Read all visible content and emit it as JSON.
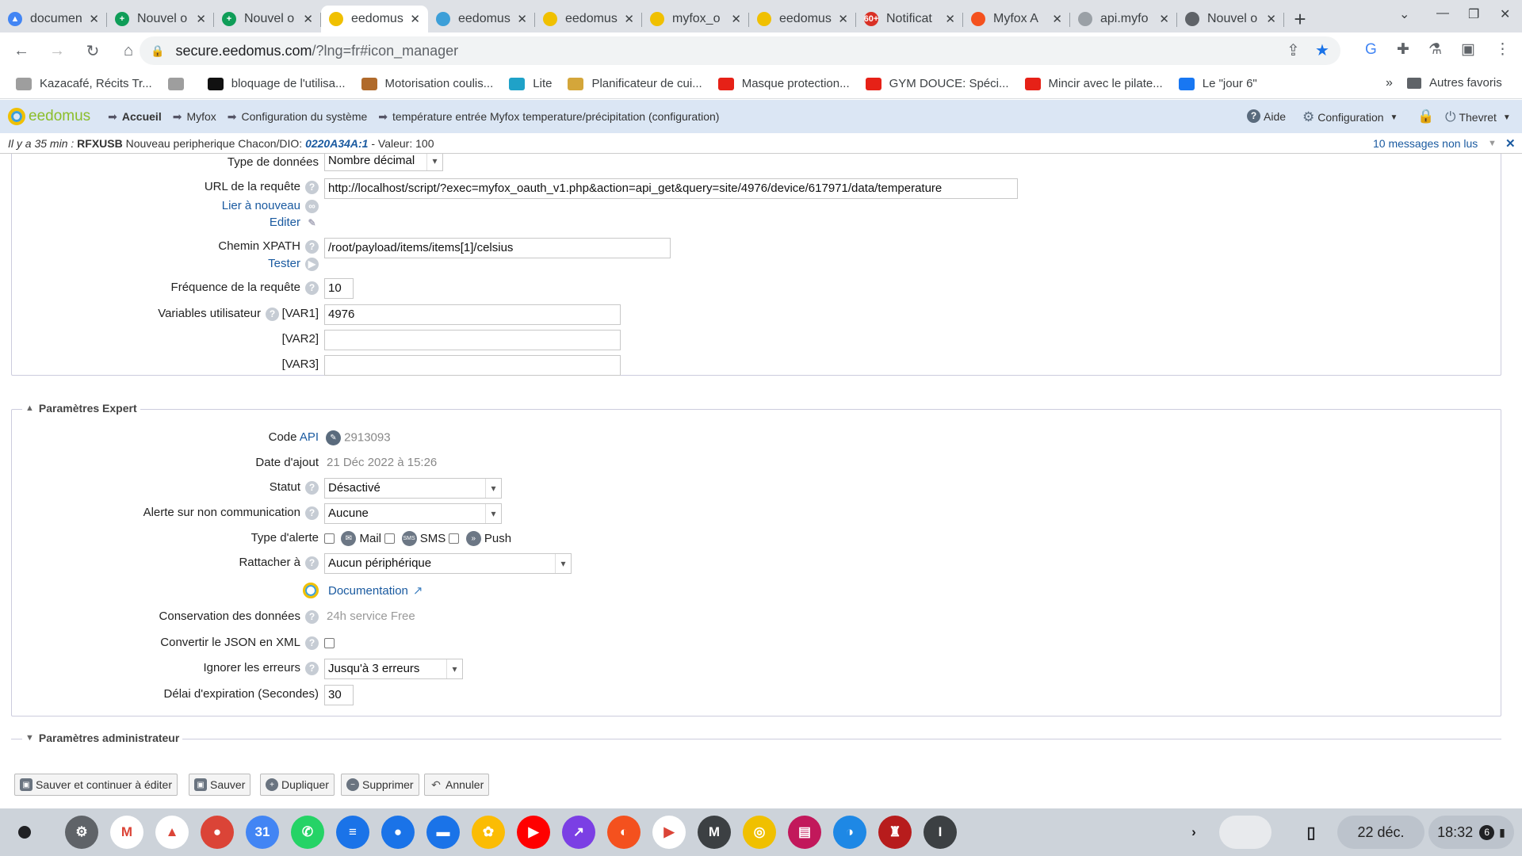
{
  "browser": {
    "tabs": [
      {
        "title": "documen",
        "color": "#4285f4",
        "glyph": "▲",
        "active": false
      },
      {
        "title": "Nouvel o",
        "color": "#0f9d58",
        "glyph": "+",
        "active": false
      },
      {
        "title": "Nouvel o",
        "color": "#0f9d58",
        "glyph": "+",
        "active": false
      },
      {
        "title": "eedomus",
        "color": "#f0c000",
        "glyph": "",
        "active": true
      },
      {
        "title": "eedomus",
        "color": "#3d9fd8",
        "glyph": "",
        "active": false
      },
      {
        "title": "eedomus",
        "color": "#f0c000",
        "glyph": "",
        "active": false
      },
      {
        "title": "myfox_o",
        "color": "#f0c000",
        "glyph": "",
        "active": false
      },
      {
        "title": "eedomus",
        "color": "#f0c000",
        "glyph": "",
        "active": false
      },
      {
        "title": "Notificat",
        "color": "#d93025",
        "glyph": "60+",
        "active": false
      },
      {
        "title": "Myfox A",
        "color": "#f4511e",
        "glyph": "",
        "active": false
      },
      {
        "title": "api.myfo",
        "color": "#9aa0a6",
        "glyph": "",
        "active": false
      },
      {
        "title": "Nouvel o",
        "color": "#5f6368",
        "glyph": "",
        "active": false
      }
    ],
    "url_host": "secure.eedomus.com",
    "url_path": "/?lng=fr#icon_manager",
    "bookmarks": [
      {
        "label": "Kazacafé, Récits Tr...",
        "color": "#9e9e9e"
      },
      {
        "label": "",
        "color": "#9e9e9e"
      },
      {
        "label": "bloquage de l'utilisa...",
        "color": "#111111"
      },
      {
        "label": "Motorisation coulis...",
        "color": "#b06a2b"
      },
      {
        "label": "Lite",
        "color": "#1fa2c8"
      },
      {
        "label": "Planificateur de cui...",
        "color": "#d4a63a"
      },
      {
        "label": "Masque protection...",
        "color": "#e62117"
      },
      {
        "label": "GYM DOUCE: Spéci...",
        "color": "#e62117"
      },
      {
        "label": "Mincir avec le pilate...",
        "color": "#e62117"
      },
      {
        "label": "Le \"jour 6\"",
        "color": "#1877f2"
      }
    ],
    "bookmarks_overflow": "»",
    "other_bookmarks": "Autres favoris"
  },
  "app": {
    "logo": "eedomus",
    "breadcrumb": [
      "Accueil",
      "Myfox",
      "Configuration du système",
      "température entrée Myfox temperature/précipitation (configuration)"
    ],
    "help": "Aide",
    "config": "Configuration",
    "user": "Thevret",
    "notification": {
      "prefix": "Il y a 35 min :",
      "device": "RFXUSB",
      "text": "Nouveau peripherique Chacon/DIO:",
      "code": "0220A34A:1",
      "value": "- Valeur: 100",
      "unread": "10 messages non lus"
    }
  },
  "form": {
    "data_type_label": "Type de données",
    "data_type_value": "Nombre décimal",
    "url_label": "URL de la requête",
    "url_value": "http://localhost/script/?exec=myfox_oauth_v1.php&action=api_get&query=site/4976/device/617971/data/temperature",
    "link_again": "Lier à nouveau",
    "edit": "Editer",
    "xpath_label": "Chemin XPATH",
    "xpath_value": "/root/payload/items/items[1]/celsius",
    "test": "Tester",
    "freq_label": "Fréquence de la requête",
    "freq_value": "10",
    "vars_label": "Variables utilisateur",
    "var1_label": "[VAR1]",
    "var1_value": "4976",
    "var2_label": "[VAR2]",
    "var2_value": "",
    "var3_label": "[VAR3]",
    "var3_value": ""
  },
  "expert": {
    "legend": "Paramètres Expert",
    "api_label": "Code",
    "api_link": "API",
    "api_value": "2913093",
    "date_label": "Date d'ajout",
    "date_value": "21 Déc 2022 à 15:26",
    "status_label": "Statut",
    "status_value": "Désactivé",
    "alert_label": "Alerte sur non communication",
    "alert_value": "Aucune",
    "alert_type_label": "Type d'alerte",
    "alert_mail": "Mail",
    "alert_sms": "SMS",
    "alert_push": "Push",
    "attach_label": "Rattacher à",
    "attach_value": "Aucun périphérique",
    "documentation": "Documentation",
    "retention_label": "Conservation des données",
    "retention_value": "24h service Free",
    "json_label": "Convertir le JSON en XML",
    "ignore_label": "Ignorer les erreurs",
    "ignore_value": "Jusqu'à 3 erreurs",
    "timeout_label": "Délai d'expiration (Secondes)",
    "timeout_value": "30"
  },
  "admin": {
    "legend": "Paramètres administrateur"
  },
  "buttons": {
    "save_continue": "Sauver et continuer à éditer",
    "save": "Sauver",
    "duplicate": "Dupliquer",
    "delete": "Supprimer",
    "cancel": "Annuler"
  },
  "taskbar": {
    "date": "22 déc.",
    "time": "18:32",
    "badge": "6",
    "icons": [
      {
        "name": "settings",
        "color": "#5f6368",
        "glyph": "⚙"
      },
      {
        "name": "gmail",
        "color": "#ffffff",
        "glyph": "M"
      },
      {
        "name": "drive",
        "color": "#ffffff",
        "glyph": "▲"
      },
      {
        "name": "chrome",
        "color": "#db4437",
        "glyph": "●"
      },
      {
        "name": "calendar",
        "color": "#4285f4",
        "glyph": "31"
      },
      {
        "name": "whatsapp",
        "color": "#25d366",
        "glyph": "✆"
      },
      {
        "name": "messages",
        "color": "#1a73e8",
        "glyph": "≡"
      },
      {
        "name": "contacts",
        "color": "#1a73e8",
        "glyph": "●"
      },
      {
        "name": "files",
        "color": "#1a73e8",
        "glyph": "▬"
      },
      {
        "name": "photos",
        "color": "#fbbc04",
        "glyph": "✿"
      },
      {
        "name": "youtube",
        "color": "#ff0000",
        "glyph": "▶"
      },
      {
        "name": "app-arrow",
        "color": "#7b3fe4",
        "glyph": "↗"
      },
      {
        "name": "app-orange",
        "color": "#f4511e",
        "glyph": "◐"
      },
      {
        "name": "play-store",
        "color": "#ffffff",
        "glyph": "▶"
      },
      {
        "name": "m-app",
        "color": "#3c4043",
        "glyph": "M"
      },
      {
        "name": "chrome-canary",
        "color": "#f0c000",
        "glyph": "◎"
      },
      {
        "name": "app-stripes",
        "color": "#c2185b",
        "glyph": "▤"
      },
      {
        "name": "app-blue",
        "color": "#1e88e5",
        "glyph": "◑"
      },
      {
        "name": "app-crest",
        "color": "#b71c1c",
        "glyph": "♜"
      },
      {
        "name": "i-app",
        "color": "#3c4043",
        "glyph": "I"
      }
    ]
  }
}
